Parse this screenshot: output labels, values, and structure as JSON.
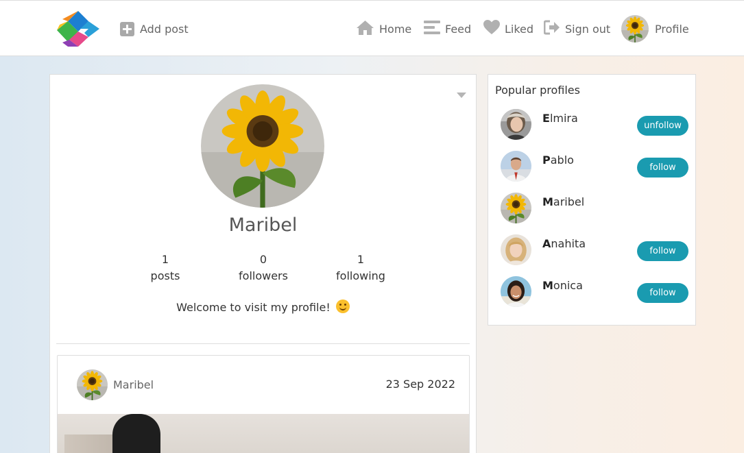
{
  "header": {
    "add_post": "Add post",
    "nav": {
      "home": "Home",
      "feed": "Feed",
      "liked": "Liked",
      "sign_out": "Sign out",
      "profile": "Profile"
    },
    "icon_color": "#b0b0b0"
  },
  "profile": {
    "name": "Maribel",
    "stats": {
      "posts_count": "1",
      "posts_label": "posts",
      "followers_count": "0",
      "followers_label": "followers",
      "following_count": "1",
      "following_label": "following"
    },
    "bio": "Welcome to visit my profile!",
    "bio_emoji": "smiling-face-icon"
  },
  "post": {
    "author": "Maribel",
    "date": "23 Sep 2022"
  },
  "popular": {
    "title": "Popular profiles",
    "accent": "#1a9bb0",
    "items": [
      {
        "initial": "E",
        "rest": "lmira",
        "button": "unfollow"
      },
      {
        "initial": "P",
        "rest": "ablo",
        "button": "follow"
      },
      {
        "initial": "M",
        "rest": "aribel",
        "button": ""
      },
      {
        "initial": "A",
        "rest": "nahita",
        "button": "follow"
      },
      {
        "initial": "M",
        "rest": "onica",
        "button": "follow"
      }
    ]
  }
}
